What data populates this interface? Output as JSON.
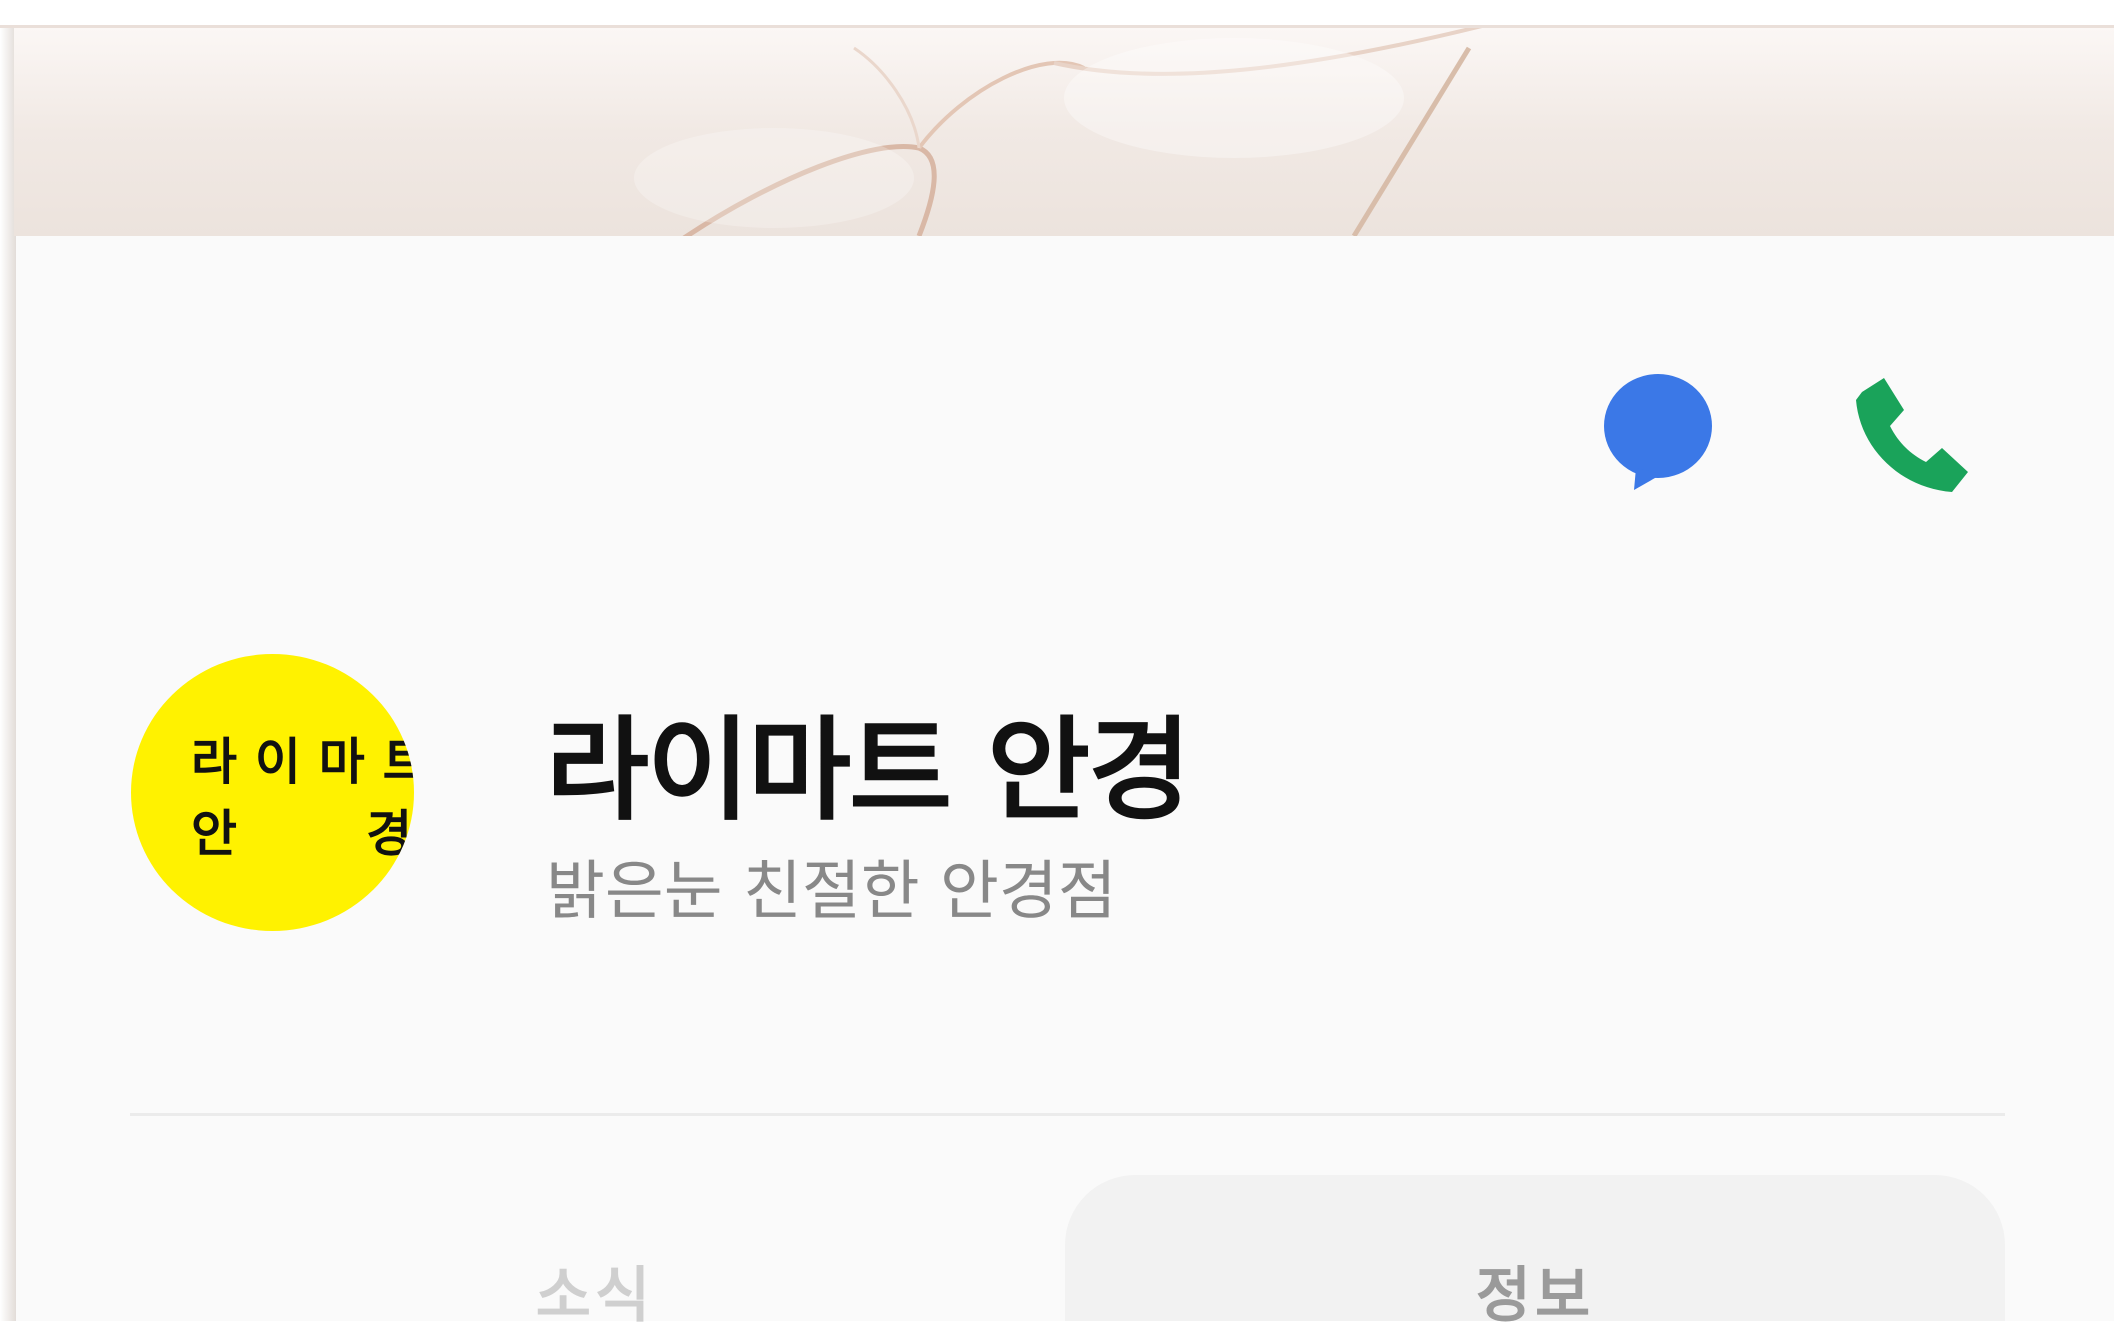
{
  "profile": {
    "name": "라이마트 안경",
    "status_message": "밝은눈 친절한 안경점",
    "logo": {
      "line1": "라 이 마 트",
      "line2": "안        경",
      "color": "#fff200"
    }
  },
  "actions": {
    "chat_icon": "chat-bubble-icon",
    "chat_color": "#3b78e7",
    "call_icon": "phone-icon",
    "call_color": "#1aa35a"
  },
  "tabs": [
    {
      "label": "소식",
      "selected": false
    },
    {
      "label": "정보",
      "selected": true
    }
  ]
}
